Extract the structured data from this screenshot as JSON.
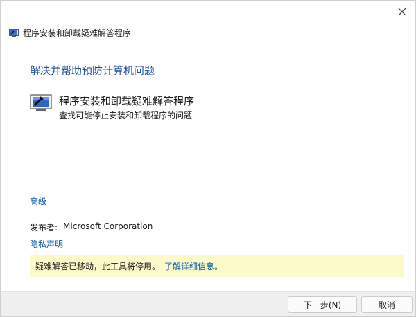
{
  "window": {
    "title": "程序安装和卸载疑难解答程序",
    "close_icon": "close-icon",
    "app_icon": "troubleshooter-icon"
  },
  "main": {
    "heading": "解决并帮助预防计算机问题",
    "tool": {
      "icon": "troubleshooter-large-icon",
      "title": "程序安装和卸载疑难解答程序",
      "description": "查找可能停止安装和卸载程序的问题"
    },
    "advanced_link": "高级",
    "publisher_label": "发布者:",
    "publisher_value": "Microsoft Corporation",
    "privacy_link": "隐私声明",
    "notice_text": "疑难解答已移动，此工具将停用。",
    "notice_link": "了解详细信息。"
  },
  "footer": {
    "next_label": "下一步(N)",
    "cancel_label": "取消"
  },
  "colors": {
    "heading": "#1c4fa0",
    "link": "#0b5cad",
    "notice_bg": "#fcfac8",
    "footer_bg": "#f0f0f0"
  }
}
